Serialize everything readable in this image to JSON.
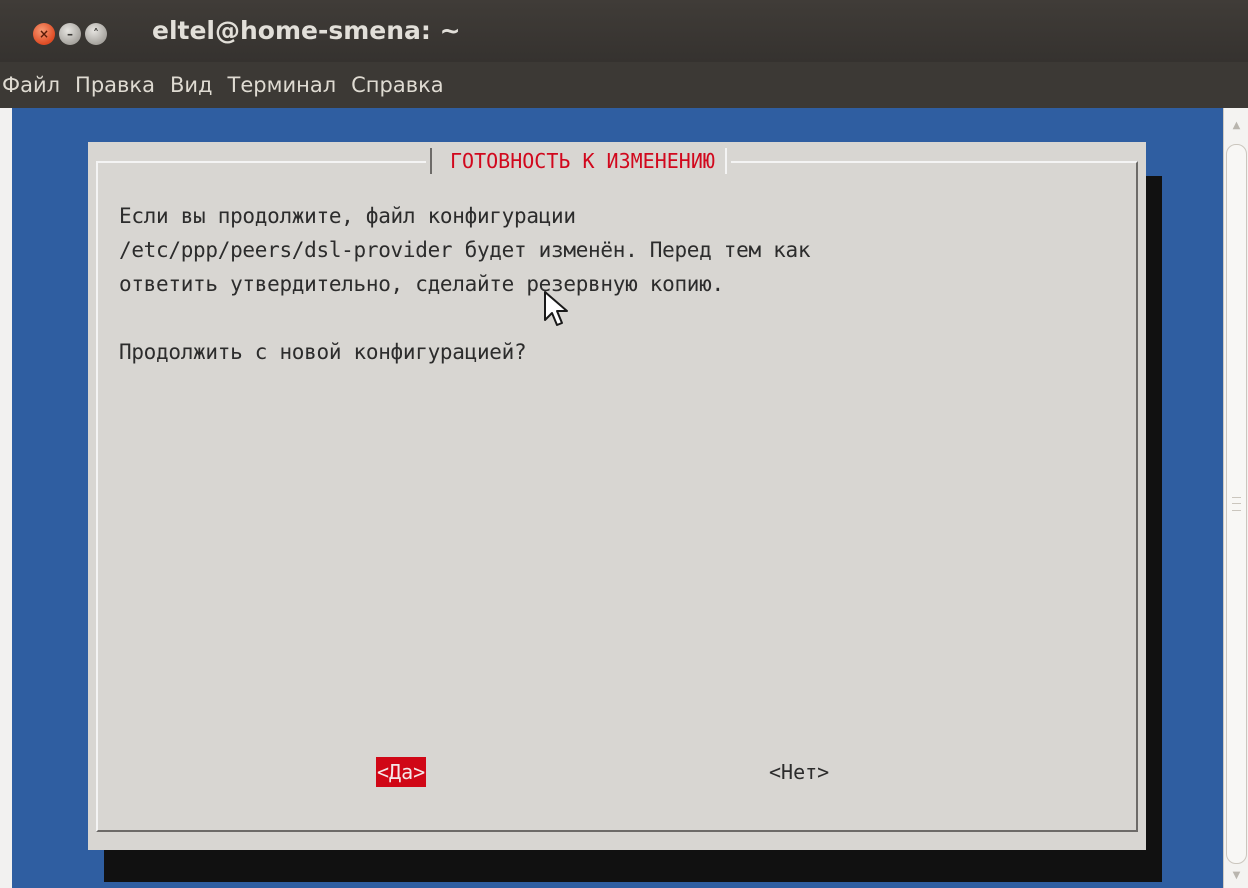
{
  "window": {
    "title": "eltel@home-smena: ~",
    "controls": [
      "close-icon",
      "minimize-icon",
      "maximize-icon"
    ]
  },
  "menubar": {
    "items": [
      "Файл",
      "Правка",
      "Вид",
      "Терминал",
      "Справка"
    ]
  },
  "dialog": {
    "title": "ГОТОВНОСТЬ К ИЗМЕНЕНИЮ",
    "lines": [
      "Если вы продолжите, файл конфигурации",
      "/etc/ppp/peers/dsl-provider будет изменён. Перед тем как",
      "ответить утвердительно, сделайте резервную копию.",
      "Продолжить с новой конфигурацией?"
    ],
    "yes_label": "<Да>",
    "no_label": "<Нет>",
    "selected": "yes"
  },
  "colors": {
    "terminal_bg": "#2f5ea1",
    "dialog_bg": "#d8d6d2",
    "accent_red": "#d1081d",
    "titlebar": "#3c3935"
  }
}
